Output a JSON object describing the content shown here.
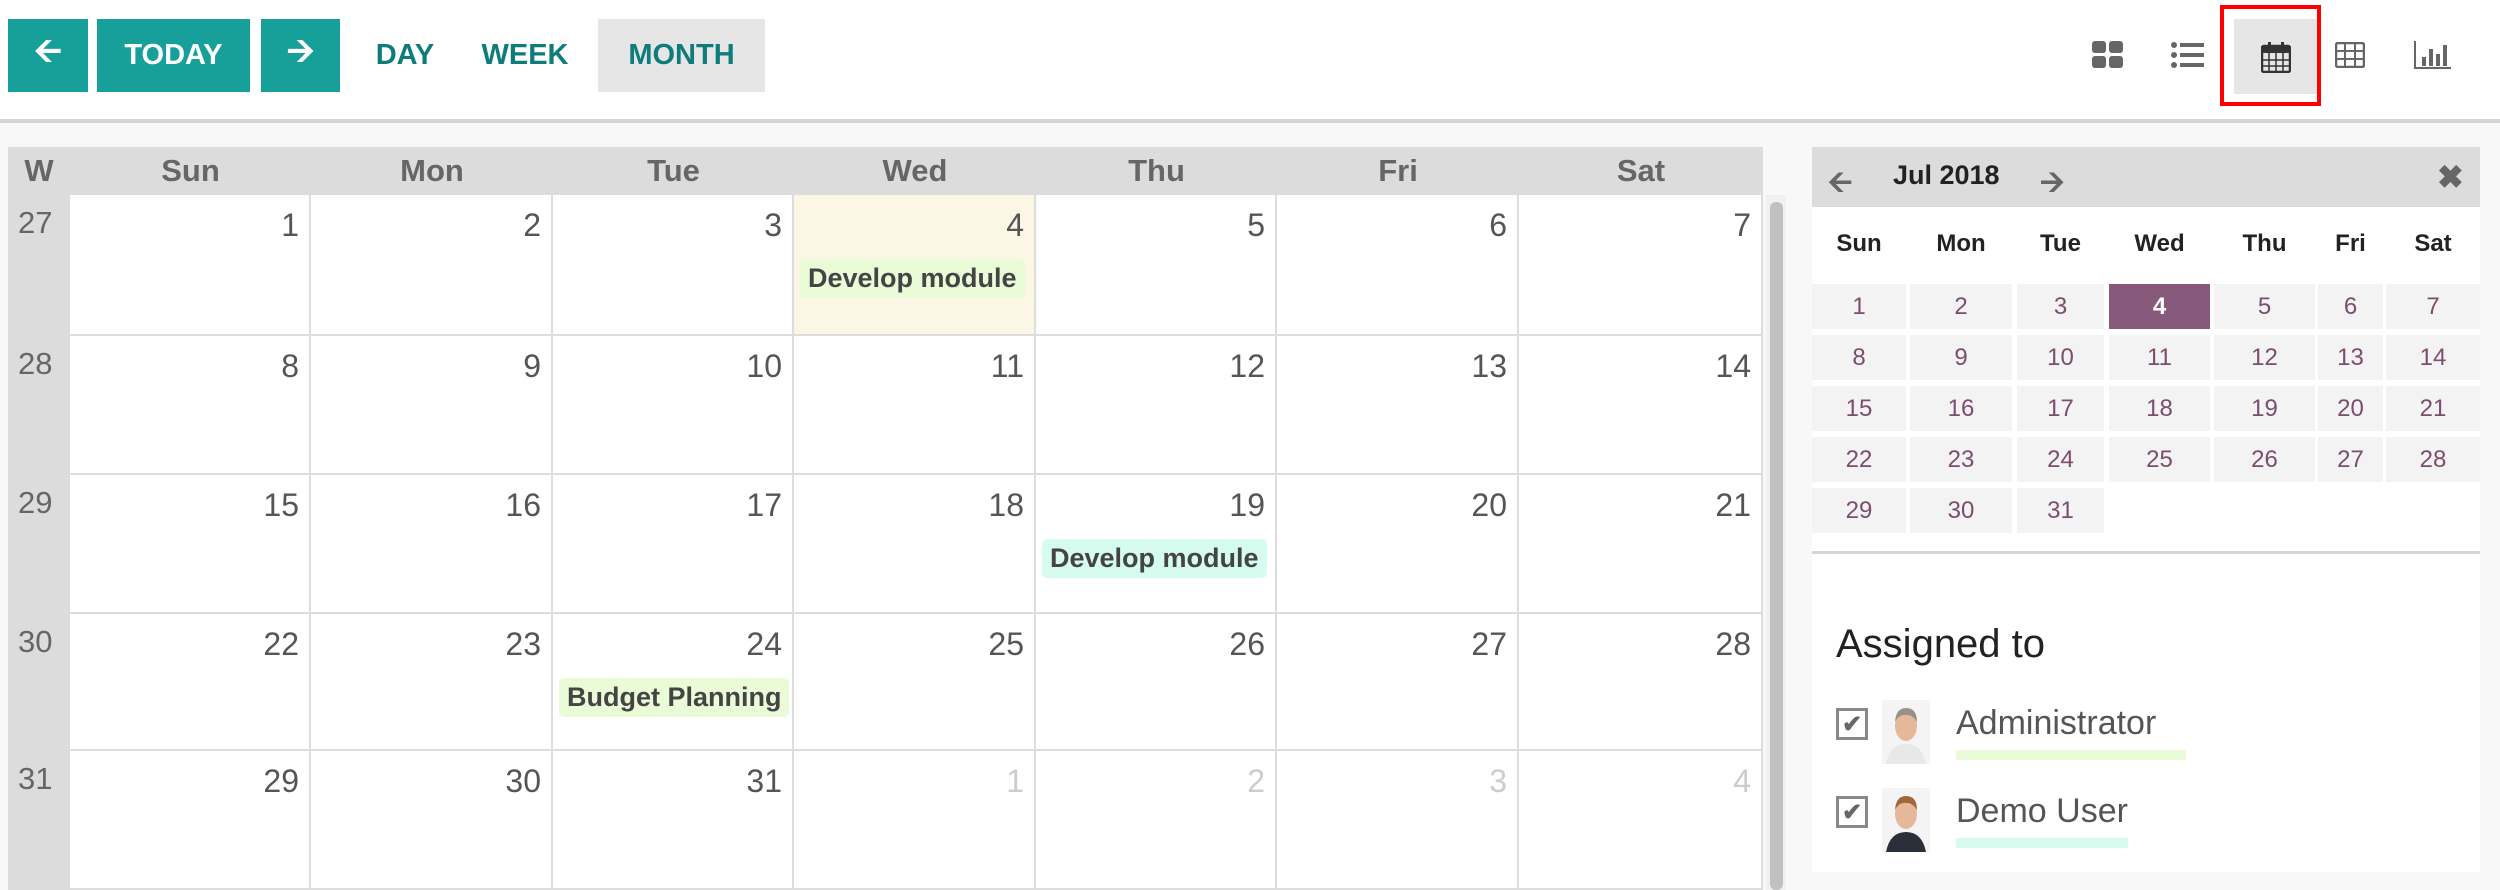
{
  "toolbar": {
    "prev_icon": "arrow-left-icon",
    "today_label": "TODAY",
    "next_icon": "arrow-right-icon",
    "views": [
      {
        "label": "DAY",
        "active": false
      },
      {
        "label": "WEEK",
        "active": false
      },
      {
        "label": "MONTH",
        "active": true
      }
    ],
    "view_switcher": [
      {
        "icon": "kanban-icon"
      },
      {
        "icon": "list-icon"
      },
      {
        "icon": "calendar-icon",
        "active": true,
        "highlighted": true
      },
      {
        "icon": "pivot-table-icon"
      },
      {
        "icon": "graph-icon"
      }
    ],
    "highlight_color": "#ff0000",
    "accent": "#17a09a"
  },
  "calendar": {
    "week_header": "W",
    "day_names": [
      "Sun",
      "Mon",
      "Tue",
      "Wed",
      "Thu",
      "Fri",
      "Sat"
    ],
    "weeks": [
      {
        "number": "27",
        "days": [
          {
            "d": "1"
          },
          {
            "d": "2"
          },
          {
            "d": "3"
          },
          {
            "d": "4",
            "today": true,
            "events": [
              {
                "title": "Develop module",
                "color": "#e9fbd7"
              }
            ]
          },
          {
            "d": "5"
          },
          {
            "d": "6"
          },
          {
            "d": "7"
          }
        ]
      },
      {
        "number": "28",
        "days": [
          {
            "d": "8"
          },
          {
            "d": "9"
          },
          {
            "d": "10"
          },
          {
            "d": "11"
          },
          {
            "d": "12"
          },
          {
            "d": "13"
          },
          {
            "d": "14"
          }
        ]
      },
      {
        "number": "29",
        "days": [
          {
            "d": "15"
          },
          {
            "d": "16"
          },
          {
            "d": "17"
          },
          {
            "d": "18"
          },
          {
            "d": "19",
            "events": [
              {
                "title": "Develop module",
                "color": "#d6fbef"
              }
            ]
          },
          {
            "d": "20"
          },
          {
            "d": "21"
          }
        ]
      },
      {
        "number": "30",
        "days": [
          {
            "d": "22"
          },
          {
            "d": "23"
          },
          {
            "d": "24",
            "events": [
              {
                "title": "Budget Planning",
                "color": "#e9fbd7"
              }
            ]
          },
          {
            "d": "25"
          },
          {
            "d": "26"
          },
          {
            "d": "27"
          },
          {
            "d": "28"
          }
        ]
      },
      {
        "number": "31",
        "days": [
          {
            "d": "29"
          },
          {
            "d": "30"
          },
          {
            "d": "31"
          },
          {
            "d": "1",
            "muted": true
          },
          {
            "d": "2",
            "muted": true
          },
          {
            "d": "3",
            "muted": true
          },
          {
            "d": "4",
            "muted": true
          }
        ]
      }
    ]
  },
  "mini_calendar": {
    "title": "Jul 2018",
    "day_names": [
      "Sun",
      "Mon",
      "Tue",
      "Wed",
      "Thu",
      "Fri",
      "Sat"
    ],
    "days": [
      "1",
      "2",
      "3",
      "4",
      "5",
      "6",
      "7",
      "8",
      "9",
      "10",
      "11",
      "12",
      "13",
      "14",
      "15",
      "16",
      "17",
      "18",
      "19",
      "20",
      "21",
      "22",
      "23",
      "24",
      "25",
      "26",
      "27",
      "28",
      "29",
      "30",
      "31"
    ],
    "selected": "4",
    "selected_color": "#875a7b"
  },
  "filters": {
    "title": "Assigned to",
    "users": [
      {
        "name": "Administrator",
        "checked": true,
        "color": "#e9fbd7"
      },
      {
        "name": "Demo User",
        "checked": true,
        "color": "#d6fbef"
      }
    ]
  }
}
